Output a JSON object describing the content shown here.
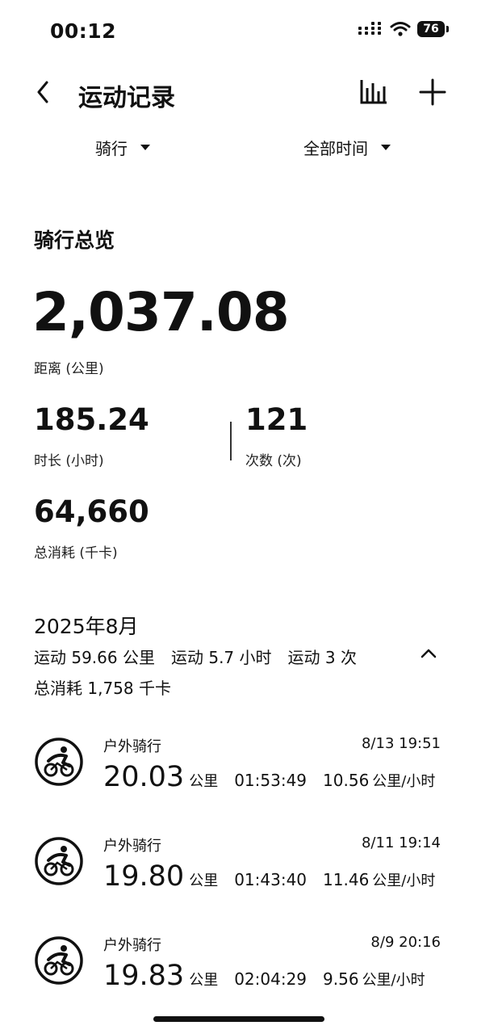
{
  "status_bar": {
    "time": "00:12",
    "battery": "76"
  },
  "header": {
    "title": "运动记录"
  },
  "filters": {
    "sport": "骑行",
    "range": "全部时间"
  },
  "overview": {
    "title": "骑行总览",
    "distance": {
      "value": "2,037.08",
      "label": "距离 (公里)"
    },
    "duration": {
      "value": "185.24",
      "label": "时长 (小时)"
    },
    "count": {
      "value": "121",
      "label": "次数 (次)"
    },
    "calories": {
      "value": "64,660",
      "label": "总消耗 (千卡)"
    }
  },
  "month": {
    "title": "2025年8月",
    "distance": "运动 59.66 公里",
    "duration": "运动 5.7 小时",
    "count": "运动 3 次",
    "calories": "总消耗 1,758 千卡"
  },
  "records": [
    {
      "type": "户外骑行",
      "date": "8/13 19:51",
      "distance": "20.03",
      "distance_unit": "公里",
      "duration": "01:53:49",
      "speed": "10.56",
      "speed_unit": "公里/小时"
    },
    {
      "type": "户外骑行",
      "date": "8/11 19:14",
      "distance": "19.80",
      "distance_unit": "公里",
      "duration": "01:43:40",
      "speed": "11.46",
      "speed_unit": "公里/小时"
    },
    {
      "type": "户外骑行",
      "date": "8/9 20:16",
      "distance": "19.83",
      "distance_unit": "公里",
      "duration": "02:04:29",
      "speed": "9.56",
      "speed_unit": "公里/小时"
    }
  ],
  "icons": {
    "back": "chevron-left-icon",
    "chart": "bar-chart-icon",
    "add": "plus-icon",
    "cycling": "cycling-icon",
    "collapse": "chevron-up-icon"
  }
}
